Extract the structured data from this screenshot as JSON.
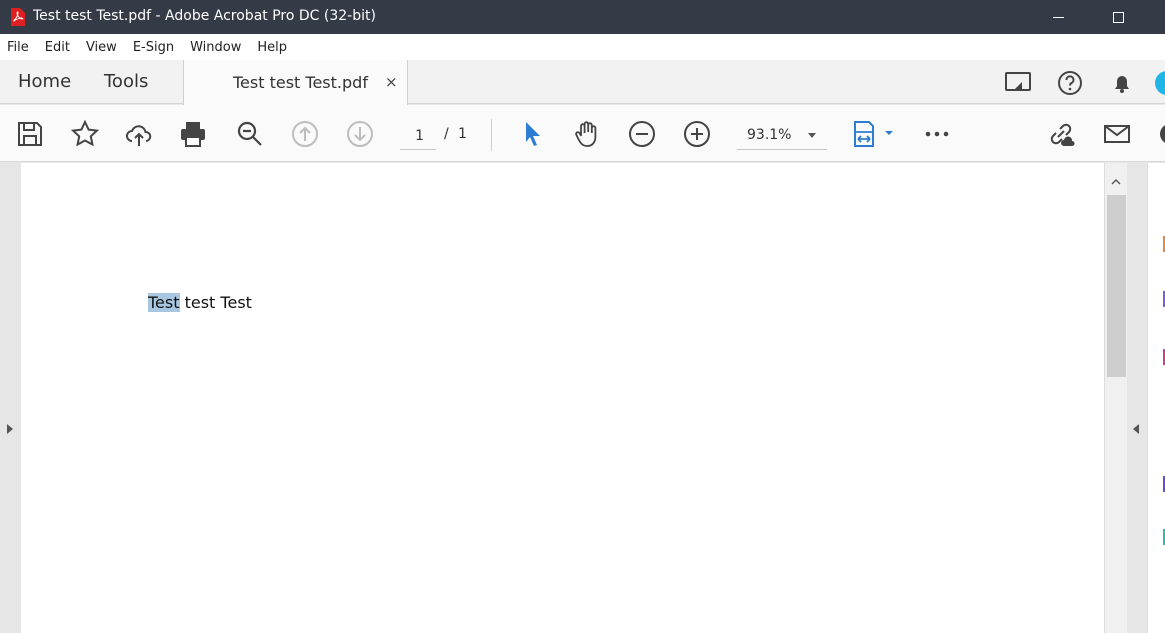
{
  "titlebar": {
    "title": "Test test Test.pdf - Adobe Acrobat Pro DC (32-bit)"
  },
  "menu": [
    "File",
    "Edit",
    "View",
    "E-Sign",
    "Window",
    "Help"
  ],
  "tabs": {
    "home": "Home",
    "tools": "Tools",
    "document": "Test test Test.pdf",
    "close": "×"
  },
  "toolbar": {
    "page_current": "1",
    "page_separator": "/",
    "page_total": "1",
    "zoom": "93.1%"
  },
  "document": {
    "selected_word": "Test",
    "rest_text": " test Test"
  },
  "icons": [
    "pdf-icon",
    "save-icon",
    "star-icon",
    "upload-cloud-icon",
    "print-icon",
    "zoom-search-icon",
    "page-up-icon",
    "page-down-icon",
    "select-arrow-icon",
    "hand-icon",
    "zoom-out-icon",
    "zoom-in-icon",
    "fit-page-icon",
    "more-icon",
    "link-cloud-icon",
    "mail-icon",
    "share-screen-icon",
    "help-icon",
    "bell-icon"
  ],
  "colors": {
    "titlebar": "#343a46",
    "accent": "#2d7dd2",
    "selection": "#a8c6e0"
  }
}
